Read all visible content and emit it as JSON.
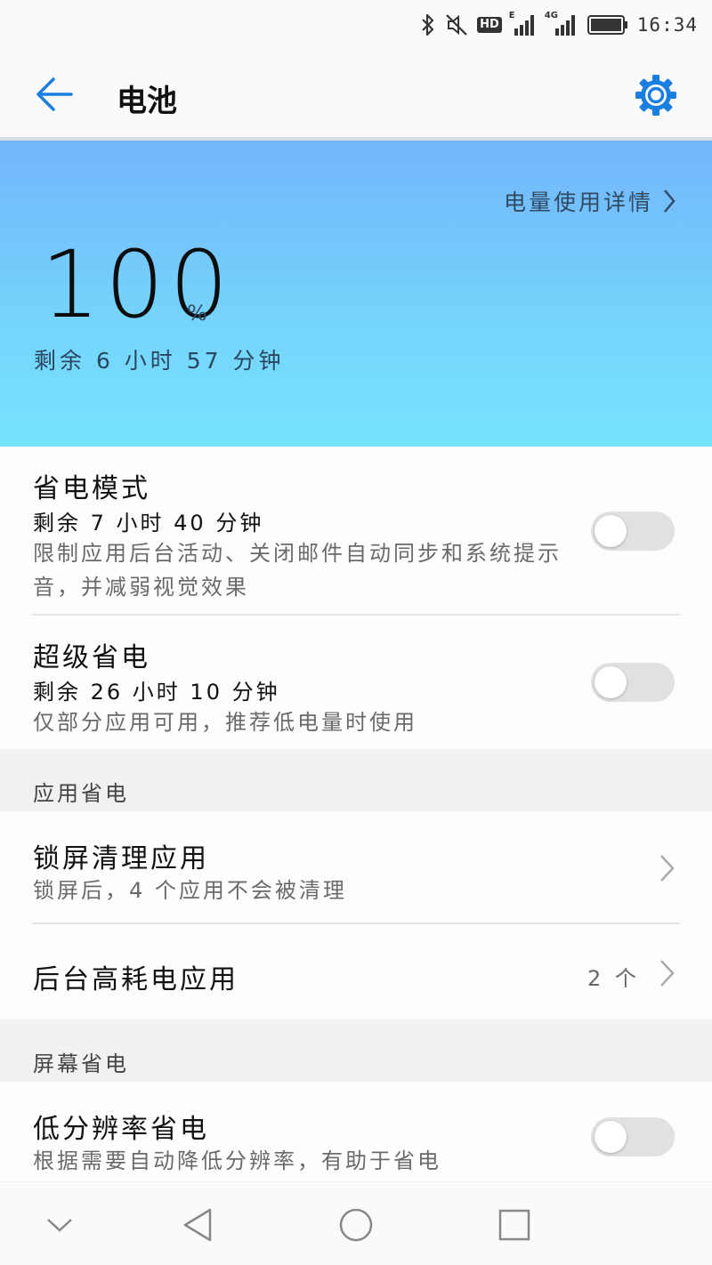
{
  "status_bar": {
    "hd_label": "HD",
    "net1_label": "E",
    "net2_label": "4G",
    "time": "16:34",
    "icons": [
      "bluetooth-icon",
      "mute-icon",
      "hd-icon",
      "signal-icon",
      "signal-4g-icon",
      "battery-icon"
    ]
  },
  "header": {
    "title": "电池",
    "back_icon": "arrow-left-icon",
    "settings_icon": "gear-icon"
  },
  "hero": {
    "usage_link": "电量使用详情",
    "level": "100",
    "unit": "%",
    "remaining": "剩余 6 小时 57 分钟"
  },
  "modes": {
    "power_saving": {
      "title": "省电模式",
      "remaining": "剩余 7 小时 40 分钟",
      "description": "限制应用后台活动、关闭邮件自动同步和系统提示音，并减弱视觉效果",
      "enabled": false
    },
    "ultra_saving": {
      "title": "超级省电",
      "remaining": "剩余 26 小时 10 分钟",
      "description": "仅部分应用可用，推荐低电量时使用",
      "enabled": false
    }
  },
  "app_saving": {
    "header": "应用省电",
    "lock_clean": {
      "title": "锁屏清理应用",
      "description": "锁屏后，4 个应用不会被清理"
    },
    "background_heavy": {
      "title": "后台高耗电应用",
      "value": "2 个"
    }
  },
  "screen_saving": {
    "header": "屏幕省电",
    "low_resolution": {
      "title": "低分辨率省电",
      "description": "根据需要自动降低分辨率，有助于省电",
      "enabled": false
    }
  },
  "colors": {
    "accent": "#1a7fe0",
    "hero_top": "#72b5fb",
    "hero_bottom": "#76e3fd"
  }
}
